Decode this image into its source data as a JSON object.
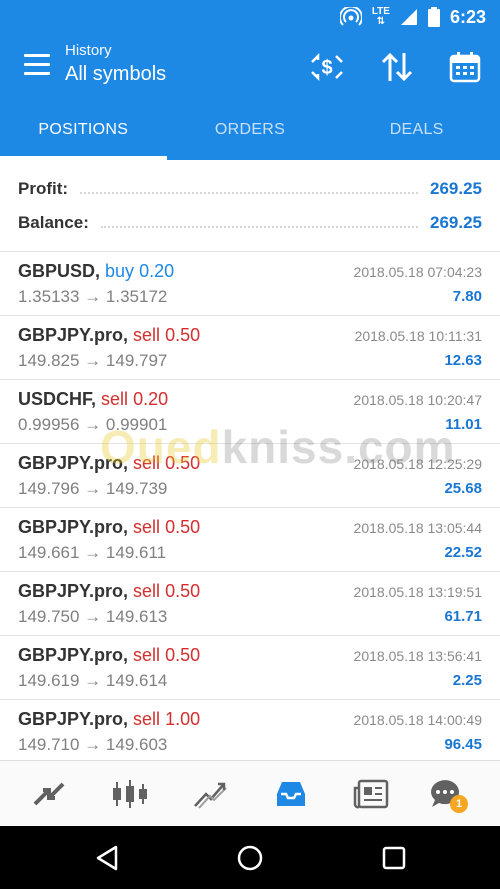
{
  "status_bar": {
    "time": "6:23",
    "network": "LTE",
    "icons": [
      "hotspot-icon",
      "lte-icon",
      "signal-icon",
      "battery-icon"
    ]
  },
  "header": {
    "subtitle": "History",
    "title": "All symbols",
    "icons": [
      "currency-exchange-icon",
      "sort-icon",
      "calendar-icon"
    ]
  },
  "tabs": [
    {
      "label": "POSITIONS",
      "active": true
    },
    {
      "label": "ORDERS",
      "active": false
    },
    {
      "label": "DEALS",
      "active": false
    }
  ],
  "summary": {
    "profit_label": "Profit:",
    "profit_value": "269.25",
    "balance_label": "Balance:",
    "balance_value": "269.25"
  },
  "deals": [
    {
      "symbol": "GBPUSD,",
      "side": "buy",
      "volume": "0.20",
      "open": "1.35133",
      "close": "1.35172",
      "date": "2018.05.18 07:04:23",
      "profit": "7.80"
    },
    {
      "symbol": "GBPJPY.pro,",
      "side": "sell",
      "volume": "0.50",
      "open": "149.825",
      "close": "149.797",
      "date": "2018.05.18 10:11:31",
      "profit": "12.63"
    },
    {
      "symbol": "USDCHF,",
      "side": "sell",
      "volume": "0.20",
      "open": "0.99956",
      "close": "0.99901",
      "date": "2018.05.18 10:20:47",
      "profit": "11.01"
    },
    {
      "symbol": "GBPJPY.pro,",
      "side": "sell",
      "volume": "0.50",
      "open": "149.796",
      "close": "149.739",
      "date": "2018.05.18 12:25:29",
      "profit": "25.68"
    },
    {
      "symbol": "GBPJPY.pro,",
      "side": "sell",
      "volume": "0.50",
      "open": "149.661",
      "close": "149.611",
      "date": "2018.05.18 13:05:44",
      "profit": "22.52"
    },
    {
      "symbol": "GBPJPY.pro,",
      "side": "sell",
      "volume": "0.50",
      "open": "149.750",
      "close": "149.613",
      "date": "2018.05.18 13:19:51",
      "profit": "61.71"
    },
    {
      "symbol": "GBPJPY.pro,",
      "side": "sell",
      "volume": "0.50",
      "open": "149.619",
      "close": "149.614",
      "date": "2018.05.18 13:56:41",
      "profit": "2.25"
    },
    {
      "symbol": "GBPJPY.pro,",
      "side": "sell",
      "volume": "1.00",
      "open": "149.710",
      "close": "149.603",
      "date": "2018.05.18 14:00:49",
      "profit": "96.45"
    }
  ],
  "watermark": {
    "text_a": "Oued",
    "text_b": "kniss.com"
  },
  "bottom_nav": {
    "items": [
      "quotes-icon",
      "chart-icon",
      "trade-icon",
      "history-icon",
      "news-icon",
      "chat-icon"
    ],
    "active_index": 3,
    "chat_badge": "1"
  },
  "colors": {
    "primary": "#1e88e5",
    "buy": "#1e88e5",
    "sell": "#d32f2f",
    "profit": "#1976d2"
  }
}
